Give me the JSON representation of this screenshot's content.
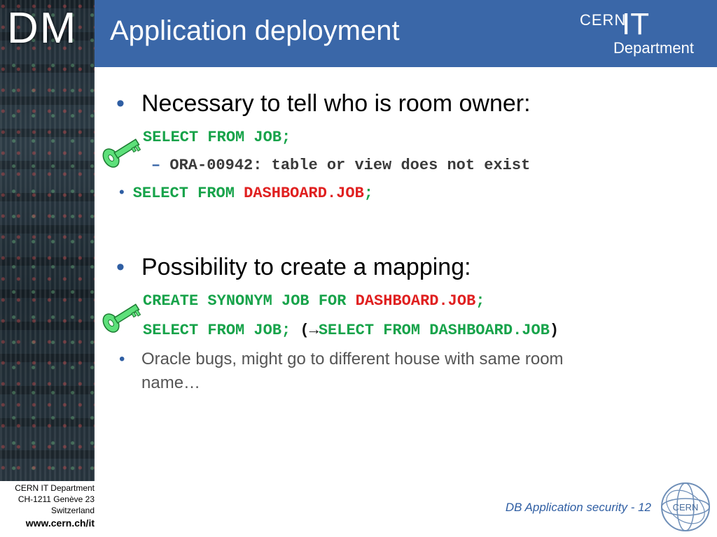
{
  "branding": {
    "dm_logo": "DM",
    "cern": "CERN",
    "it": "IT",
    "department": "Department",
    "seal_text": "CERN"
  },
  "slide": {
    "title": "Application deployment",
    "bullet1": "Necessary to tell who is room owner:",
    "code1": "SELECT FROM JOB;",
    "dash": "–",
    "error": "ORA-00942: table or view does not exist",
    "code2_prefix": "SELECT FROM ",
    "code2_table": "DASHBOARD.JOB",
    "code2_suffix": ";",
    "bullet2": "Possibility to create a mapping:",
    "code3_prefix": "CREATE SYNONYM JOB FOR ",
    "code3_table": "DASHBOARD.JOB",
    "code3_suffix": ";",
    "code4_prefix": "SELECT FROM JOB; ",
    "code4_paren_open": "(",
    "code4_arrow": "→",
    "code4_target": "SELECT FROM DASHBOARD.JOB",
    "code4_paren_close": ")",
    "bullet3_line1": "Oracle bugs, might go to different house with same room",
    "bullet3_line2": "name…"
  },
  "footer": {
    "dept": "CERN IT Department",
    "address": "CH-1211 Genève 23",
    "country": "Switzerland",
    "url": "www.cern.ch/it",
    "slide_label": "DB Application security - 12"
  },
  "colors": {
    "header_blue": "#3a67a8",
    "code_green": "#17a34a",
    "code_red": "#e02020",
    "key_green": "#5de07a",
    "bullet_blue": "#2f5ea3"
  },
  "icons": [
    "key-icon",
    "cern-seal-icon"
  ]
}
